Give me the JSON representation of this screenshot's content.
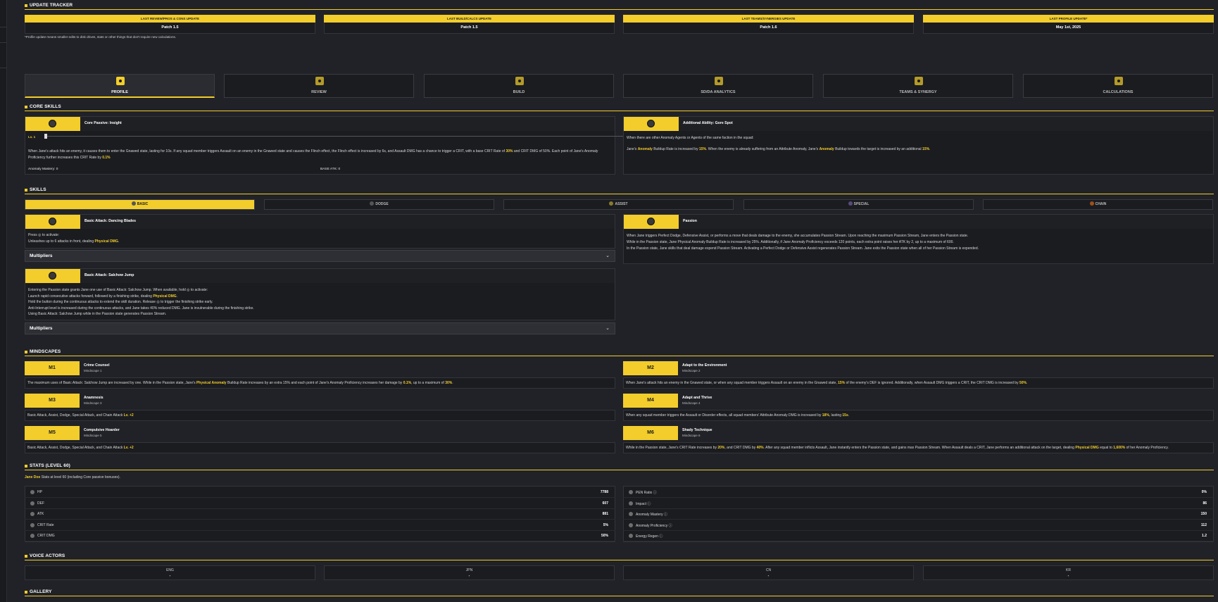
{
  "sections": {
    "update_tracker": "UPDATE TRACKER",
    "core_skills": "CORE SKILLS",
    "skills": "SKILLS",
    "mindscapes": "MINDSCAPES",
    "stats": "STATS (LEVEL 60)",
    "voice_actors": "VOICE ACTORS",
    "gallery": "GALLERY"
  },
  "tracker": [
    {
      "label": "LAST REVIEW/PROS & CONS UPDATE",
      "value": "Patch 1.5"
    },
    {
      "label": "LAST BUILD/CALCS UPDATE",
      "value": "Patch 1.5"
    },
    {
      "label": "LAST TEAMS/SYNERGIES UPDATE",
      "value": "Patch 1.6"
    },
    {
      "label": "LAST PROFILE UPDATE*",
      "value": "May 1st, 2025"
    }
  ],
  "tracker_note": "*Profile update means smaller edits to disk drives, stats or other things that don't require new calculations.",
  "tabs": [
    {
      "label": "PROFILE",
      "icon": "profile-icon"
    },
    {
      "label": "REVIEW",
      "icon": "review-icon"
    },
    {
      "label": "BUILD",
      "icon": "build-icon"
    },
    {
      "label": "SD/DA ANALYTICS",
      "icon": "analytics-icon"
    },
    {
      "label": "TEAMS & SYNERGY",
      "icon": "teams-icon"
    },
    {
      "label": "CALCULATIONS",
      "icon": "calculations-icon"
    }
  ],
  "core": {
    "passive_title": "Core Passive: Insight",
    "level_label": "Lv. 1",
    "passive_desc_a": "When Jane's attack hits an enemy, it causes them to enter the Gnawed state, lasting for 10s. If any squad member triggers Assault on an enemy in the Gnawed state and causes the Flinch effect, the Flinch effect is increased by 6s, and Assault DMG has a chance to trigger a CRIT, with a base CRIT Rate of ",
    "passive_hl1": "30%",
    "passive_desc_b": " and CRIT DMG of 50%. Each point of Jane's Anomaly Proficiency further increases this CRIT Rate by ",
    "passive_hl2": "0.1%",
    "anomaly_mastery": "Anomaly Mastery: 0",
    "base_atk": "BASE ATK: 0",
    "ability_title": "Additional Ability: Gore Spot",
    "ability_cond": "When there are other Anomaly Agents or Agents of the same faction in the squad:",
    "ability_a": "Jane's ",
    "ability_hl1": "Anomaly",
    "ability_b": " Buildup Rate is increased by ",
    "ability_hl2": "15%",
    "ability_c": ". When the enemy is already suffering from an Attribute Anomaly, Jane's ",
    "ability_hl3": "Anomaly",
    "ability_d": " Buildup towards the target is increased by an additional ",
    "ability_hl4": "15%",
    "ability_e": "."
  },
  "skill_tabs": [
    "BASIC",
    "DODGE",
    "ASSIST",
    "SPECIAL",
    "CHAIN"
  ],
  "skills": {
    "basic1_title": "Basic Attack: Dancing Blades",
    "basic1_l1": "Press ◎ to activate:",
    "basic1_l2a": "Unleashes up to 6 attacks in front, dealing ",
    "basic1_l2hl": "Physical DMG",
    "basic1_l2b": ".",
    "multipliers": "Multipliers",
    "basic2_title": "Basic Attack: Salchow Jump",
    "basic2_l1": "Entering the Passion state grants Jane one use of Basic Attack: Salchow Jump. When available, hold ◎ to activate:",
    "basic2_l2a": "Launch rapid consecutive attacks forward, followed by a finishing strike, dealing ",
    "basic2_l2hl": "Physical DMG",
    "basic2_l2b": ".",
    "basic2_l3": "Hold the button during the continuous attacks to extend the skill duration. Release ◎ to trigger the finishing strike early.",
    "basic2_l4": "Anti-Interrupt level is increased during the continuous attacks, and Jane takes 40% reduced DMG. Jane is invulnerable during the finishing strike.",
    "basic2_l5": "Using Basic Attack: Salchow Jump while in the Passion state generates Passion Stream.",
    "passion_title": "Passion",
    "passion_l1": "When Jane triggers Perfect Dodge, Defensive Assist, or performs a move that deals damage to the enemy, she accumulates Passion Stream. Upon reaching the maximum Passion Stream, Jane enters the Passion state.",
    "passion_l2": "While in the Passion state, Jane Physical Anomaly Buildup Rate is increased by 25%. Additionally, if Jane Anomaly Proficiency exceeds 120 points, each extra point raises her ATK by 2, up to a maximum of 600.",
    "passion_l3": "In the Passion state, Jane skills that deal damage expend Passion Stream. Activating a Perfect Dodge or Defensive Assist regenerates Passion Stream. Jane exits the Passion state when all of her Passion Stream is expended."
  },
  "mindscapes": [
    {
      "badge": "M1",
      "title": "Crime Counsel",
      "sub": "Mindscape 1",
      "parts": [
        [
          "The maximum uses of Basic Attack: Salchow Jump are increased by one. While in the Passion state, Jane's ",
          false
        ],
        [
          "Physical Anomaly",
          true
        ],
        [
          " Buildup Rate increases by an extra 15% and each point of Jane's Anomaly Proficiency increases her damage by ",
          false
        ],
        [
          "0.1%",
          true
        ],
        [
          ", up to a maximum of ",
          false
        ],
        [
          "30%",
          true
        ],
        [
          ".",
          false
        ]
      ]
    },
    {
      "badge": "M2",
      "title": "Adapt to the Environment",
      "sub": "Mindscape 2",
      "parts": [
        [
          "When Jane's attack hits an enemy in the Gnawed state, or when any squad member triggers Assault on an enemy in the Gnawed state, ",
          false
        ],
        [
          "15%",
          true
        ],
        [
          " of the enemy's DEF is ignored. Additionally, when Assault DMG triggers a CRIT, the CRIT DMG is increased by ",
          false
        ],
        [
          "50%",
          true
        ],
        [
          ".",
          false
        ]
      ]
    },
    {
      "badge": "M3",
      "title": "Anamnesis",
      "sub": "Mindscape 3",
      "parts": [
        [
          "Basic Attack, Assist, Dodge, Special Attack, and Chain Attack ",
          false
        ],
        [
          "Lv. +2",
          true
        ]
      ]
    },
    {
      "badge": "M4",
      "title": "Adapt and Thrive",
      "sub": "Mindscape 4",
      "parts": [
        [
          "When any squad member triggers the Assault or Disorder effects, all squad members' Attribute Anomaly DMG is increased by ",
          false
        ],
        [
          "18%",
          true
        ],
        [
          ", lasting ",
          false
        ],
        [
          "15s",
          true
        ],
        [
          ".",
          false
        ]
      ]
    },
    {
      "badge": "M5",
      "title": "Compulsive Hoarder",
      "sub": "Mindscape 5",
      "parts": [
        [
          "Basic Attack, Assist, Dodge, Special Attack, and Chain Attack ",
          false
        ],
        [
          "Lv. +2",
          true
        ]
      ]
    },
    {
      "badge": "M6",
      "title": "Shady Technique",
      "sub": "Mindscape 6",
      "parts": [
        [
          "While in the Passion state, Jane's CRIT Rate increases by ",
          false
        ],
        [
          "20%",
          true
        ],
        [
          ", and CRIT DMG by ",
          false
        ],
        [
          "40%",
          true
        ],
        [
          ". After any squad member inflicts Assault, Jane instantly enters the Passion state, and gains max Passion Stream. When Assault deals a CRIT, Jane performs an additional attack on the target, dealing ",
          false
        ],
        [
          "Physical DMG",
          true
        ],
        [
          " equal to ",
          false
        ],
        [
          "1,600%",
          true
        ],
        [
          " of her Anomaly Proficiency.",
          false
        ]
      ]
    }
  ],
  "stats_intro_hl": "Jane Doe",
  "stats_intro": " Stats at level 60 (including Core passive bonuses).",
  "stats_left": [
    {
      "label": "HP",
      "value": "7788",
      "icon": "hp-icon"
    },
    {
      "label": "DEF",
      "value": "607",
      "icon": "def-icon"
    },
    {
      "label": "ATK",
      "value": "881",
      "icon": "atk-icon"
    },
    {
      "label": "CRIT Rate",
      "value": "5%",
      "icon": "crit-rate-icon"
    },
    {
      "label": "CRIT DMG",
      "value": "50%",
      "icon": "crit-dmg-icon"
    }
  ],
  "stats_right": [
    {
      "label": "PEN Ratio ⓘ",
      "value": "0%",
      "icon": "pen-ratio-icon"
    },
    {
      "label": "Impact ⓘ",
      "value": "86",
      "icon": "impact-icon"
    },
    {
      "label": "Anomaly Mastery ⓘ",
      "value": "150",
      "icon": "anomaly-mastery-icon"
    },
    {
      "label": "Anomaly Proficiency ⓘ",
      "value": "112",
      "icon": "anomaly-proficiency-icon"
    },
    {
      "label": "Energy Regen ⓘ",
      "value": "1.2",
      "icon": "energy-regen-icon"
    }
  ],
  "voice": [
    {
      "label": "ENG",
      "value": "-"
    },
    {
      "label": "JPN",
      "value": "-"
    },
    {
      "label": "CN",
      "value": "-"
    },
    {
      "label": "KR",
      "value": "-"
    }
  ],
  "colors": {
    "accent": "#f2cd2c",
    "bg": "#212227",
    "panel": "#1b1c20"
  }
}
